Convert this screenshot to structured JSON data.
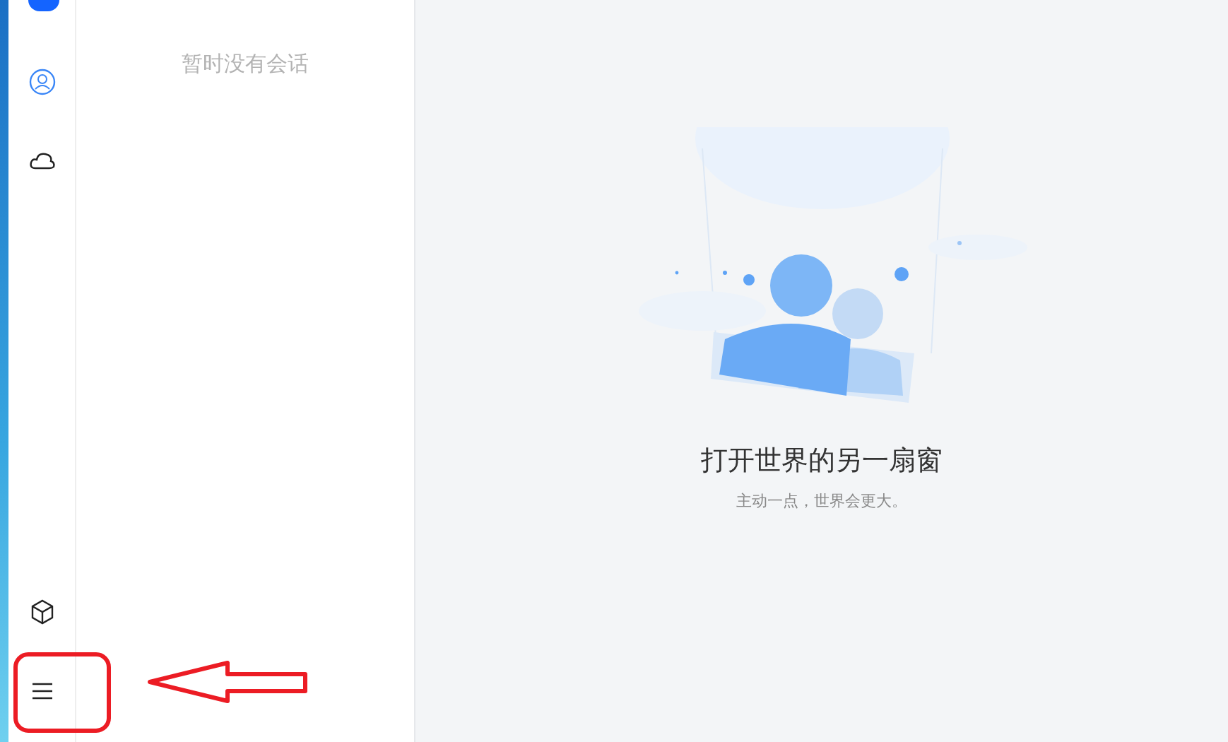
{
  "sidebar": {
    "top_items": [
      {
        "kind": "contacts",
        "selected": true
      },
      {
        "kind": "cloud",
        "selected": false
      }
    ],
    "bottom_items": [
      {
        "kind": "cube",
        "selected": false
      },
      {
        "kind": "menu",
        "selected": false
      }
    ]
  },
  "conversation_list": {
    "empty_text": "暂时没有会话"
  },
  "main": {
    "title": "打开世界的另一扇窗",
    "subtitle": "主动一点，世界会更大。"
  }
}
